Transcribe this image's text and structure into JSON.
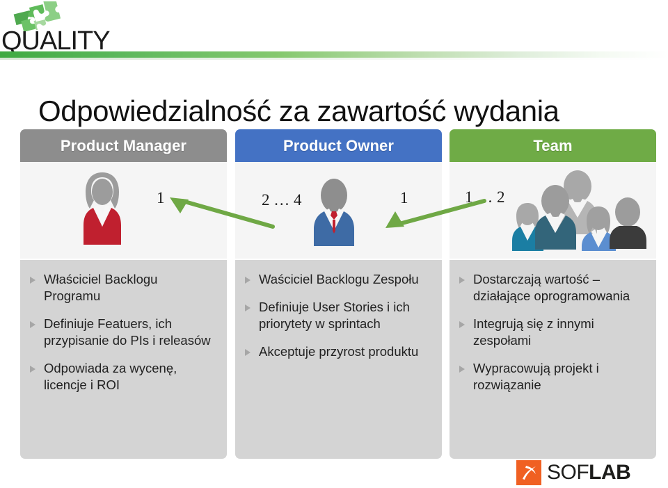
{
  "brand": {
    "logo_wordmark": "QUALITY",
    "logo_icon": "puzzle-pieces-icon",
    "accent_green": "#5cb85c"
  },
  "title": "Odpowiedzialność za zawartość wydania",
  "columns": [
    {
      "id": "product-manager",
      "header": "Product Manager",
      "header_color": "#8d8d8d",
      "figure_icon": "woman-silhouette-icon",
      "numbers": [
        "1"
      ],
      "bullets": [
        "Właściciel Backlogu Programu",
        "Definiuje Featuers, ich przypisanie do PIs i releasów",
        "Odpowiada za wycenę, licencje i ROI"
      ]
    },
    {
      "id": "product-owner",
      "header": "Product Owner",
      "header_color": "#4472c4",
      "figure_icon": "businessman-silhouette-icon",
      "numbers": [
        "2 … 4",
        "1"
      ],
      "bullets": [
        "Waściciel Backlogu Zespołu",
        "Definiuje User Stories i ich priorytety w sprintach",
        "Akceptuje przyrost produktu"
      ]
    },
    {
      "id": "team",
      "header": "Team",
      "header_color": "#6fab46",
      "figure_icon": "people-group-icon",
      "numbers": [
        "1 … 2"
      ],
      "bullets": [
        "Dostarczają wartość – działające oprogramowania",
        "Integrują się z innymi zespołami",
        "Wypracowują projekt i rozwiązanie"
      ]
    }
  ],
  "arrows": {
    "color": "#6fa845",
    "po_to_pm": "2 … 4 Product Owners report to 1 Product Manager",
    "team_to_po": "1 … 2 Teams report to 1 Product Owner"
  },
  "footer": {
    "logo_prefix": "SOF",
    "logo_suffix": "LAB",
    "logo_mark": "soflab-mark-icon",
    "mark_color": "#f06022"
  }
}
